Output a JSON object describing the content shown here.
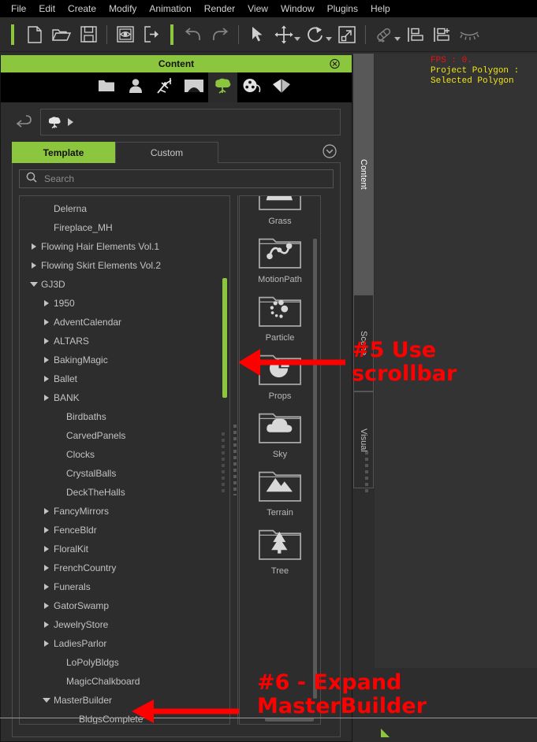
{
  "menubar": {
    "items": [
      {
        "label": "File"
      },
      {
        "label": "Edit"
      },
      {
        "label": "Create"
      },
      {
        "label": "Modify"
      },
      {
        "label": "Animation"
      },
      {
        "label": "Render"
      },
      {
        "label": "View"
      },
      {
        "label": "Window"
      },
      {
        "label": "Plugins"
      },
      {
        "label": "Help"
      }
    ]
  },
  "toolbar": {
    "accent_color": "#8cc63e",
    "buttons": [
      {
        "icon": "new-document-icon",
        "name": "new-button"
      },
      {
        "icon": "open-folder-icon",
        "name": "open-button"
      },
      {
        "icon": "save-disk-icon",
        "name": "save-button"
      },
      {
        "icon": "preview-eye-icon",
        "name": "preview-button"
      },
      {
        "icon": "export-icon",
        "name": "export-button"
      },
      {
        "icon": "undo-arrow-icon",
        "name": "undo-button"
      },
      {
        "icon": "redo-arrow-icon",
        "name": "redo-button"
      },
      {
        "icon": "select-cursor-icon",
        "name": "select-tool-button"
      },
      {
        "icon": "move-tool-icon",
        "name": "move-tool-button"
      },
      {
        "icon": "rotate-tool-icon",
        "name": "rotate-tool-button"
      },
      {
        "icon": "scale-tool-icon",
        "name": "scale-tool-button"
      },
      {
        "icon": "link-tool-icon",
        "name": "link-tool-button"
      },
      {
        "icon": "align-bottom-icon",
        "name": "align-button"
      },
      {
        "icon": "align-add-icon",
        "name": "align-add-button"
      },
      {
        "icon": "hide-lashes-icon",
        "name": "hide-button"
      }
    ]
  },
  "content_panel": {
    "title": "Content",
    "close_icon": "close-circle-icon",
    "categories": [
      {
        "icon": "folder-icon",
        "name": "category-file",
        "active": false
      },
      {
        "icon": "person-icon",
        "name": "category-character",
        "active": false
      },
      {
        "icon": "pose-icon",
        "name": "category-pose",
        "active": false
      },
      {
        "icon": "stage-icon",
        "name": "category-stage",
        "active": false
      },
      {
        "icon": "tree-icon",
        "name": "category-scene-props",
        "active": true
      },
      {
        "icon": "film-reel-icon",
        "name": "category-media",
        "active": false
      },
      {
        "icon": "package-icon",
        "name": "category-package",
        "active": false
      }
    ],
    "breadcrumb": {
      "back_icon": "back-arrow-icon",
      "root_icon": "tree-icon",
      "expand_icon": "breadcrumb-arrow-icon",
      "path": ""
    },
    "tabs": [
      {
        "label": "Template",
        "active": true
      },
      {
        "label": "Custom",
        "active": false
      }
    ],
    "tab_expander_icon": "chevron-down-circle-icon",
    "search": {
      "value": "",
      "placeholder": "Search",
      "icon": "search-icon"
    },
    "tree": [
      {
        "label": "Delerna",
        "indent": 1,
        "state": "leaf"
      },
      {
        "label": "Fireplace_MH",
        "indent": 1,
        "state": "leaf"
      },
      {
        "label": "Flowing Hair Elements Vol.1",
        "indent": 0,
        "state": "collapsed"
      },
      {
        "label": "Flowing Skirt Elements Vol.2",
        "indent": 0,
        "state": "collapsed"
      },
      {
        "label": "GJ3D",
        "indent": 0,
        "state": "expanded"
      },
      {
        "label": "1950",
        "indent": 1,
        "state": "collapsed"
      },
      {
        "label": "AdventCalendar",
        "indent": 1,
        "state": "collapsed"
      },
      {
        "label": "ALTARS",
        "indent": 1,
        "state": "collapsed"
      },
      {
        "label": "BakingMagic",
        "indent": 1,
        "state": "collapsed"
      },
      {
        "label": "Ballet",
        "indent": 1,
        "state": "collapsed"
      },
      {
        "label": "BANK",
        "indent": 1,
        "state": "collapsed"
      },
      {
        "label": "Birdbaths",
        "indent": 2,
        "state": "leaf"
      },
      {
        "label": "CarvedPanels",
        "indent": 2,
        "state": "leaf"
      },
      {
        "label": "Clocks",
        "indent": 2,
        "state": "leaf"
      },
      {
        "label": "CrystalBalls",
        "indent": 2,
        "state": "leaf"
      },
      {
        "label": "DeckTheHalls",
        "indent": 2,
        "state": "leaf"
      },
      {
        "label": "FancyMirrors",
        "indent": 1,
        "state": "collapsed"
      },
      {
        "label": "FenceBldr",
        "indent": 1,
        "state": "collapsed"
      },
      {
        "label": "FloralKit",
        "indent": 1,
        "state": "collapsed"
      },
      {
        "label": "FrenchCountry",
        "indent": 1,
        "state": "collapsed"
      },
      {
        "label": "Funerals",
        "indent": 1,
        "state": "collapsed"
      },
      {
        "label": "GatorSwamp",
        "indent": 1,
        "state": "collapsed"
      },
      {
        "label": "JewelryStore",
        "indent": 1,
        "state": "collapsed"
      },
      {
        "label": "LadiesParlor",
        "indent": 1,
        "state": "collapsed"
      },
      {
        "label": "LoPolyBldgs",
        "indent": 2,
        "state": "leaf"
      },
      {
        "label": "MagicChalkboard",
        "indent": 2,
        "state": "leaf"
      },
      {
        "label": "MasterBuilder",
        "indent": 1,
        "state": "expanded"
      },
      {
        "label": "BldgsComplete",
        "indent": 3,
        "state": "leaf"
      }
    ],
    "grid_items": [
      {
        "label": "Grass",
        "icon": "grass-folder-icon"
      },
      {
        "label": "MotionPath",
        "icon": "motionpath-folder-icon"
      },
      {
        "label": "Particle",
        "icon": "particle-folder-icon"
      },
      {
        "label": "Props",
        "icon": "props-folder-icon"
      },
      {
        "label": "Sky",
        "icon": "sky-folder-icon"
      },
      {
        "label": "Terrain",
        "icon": "terrain-folder-icon"
      },
      {
        "label": "Tree",
        "icon": "tree-folder-icon"
      }
    ]
  },
  "dock": {
    "tabs": [
      {
        "label": "Content",
        "active": true
      },
      {
        "label": "Scene",
        "active": false
      },
      {
        "label": "Visual",
        "active": false
      }
    ]
  },
  "viewport": {
    "stats": {
      "fps": "FPS : 0.",
      "project_polygon": "Project Polygon :",
      "selected_polygon": "Selected Polygon"
    },
    "fps_color": "#ee1111",
    "stat_color": "#f2e516",
    "gizmo_icon": "green-triangle-gizmo"
  },
  "annotations": [
    {
      "id": "anno5",
      "text": "#5 Use\nscrollbar",
      "color": "#ff0000"
    },
    {
      "id": "anno6",
      "text": "#6 - Expand\nMasterBuilder",
      "color": "#ff0000"
    }
  ]
}
